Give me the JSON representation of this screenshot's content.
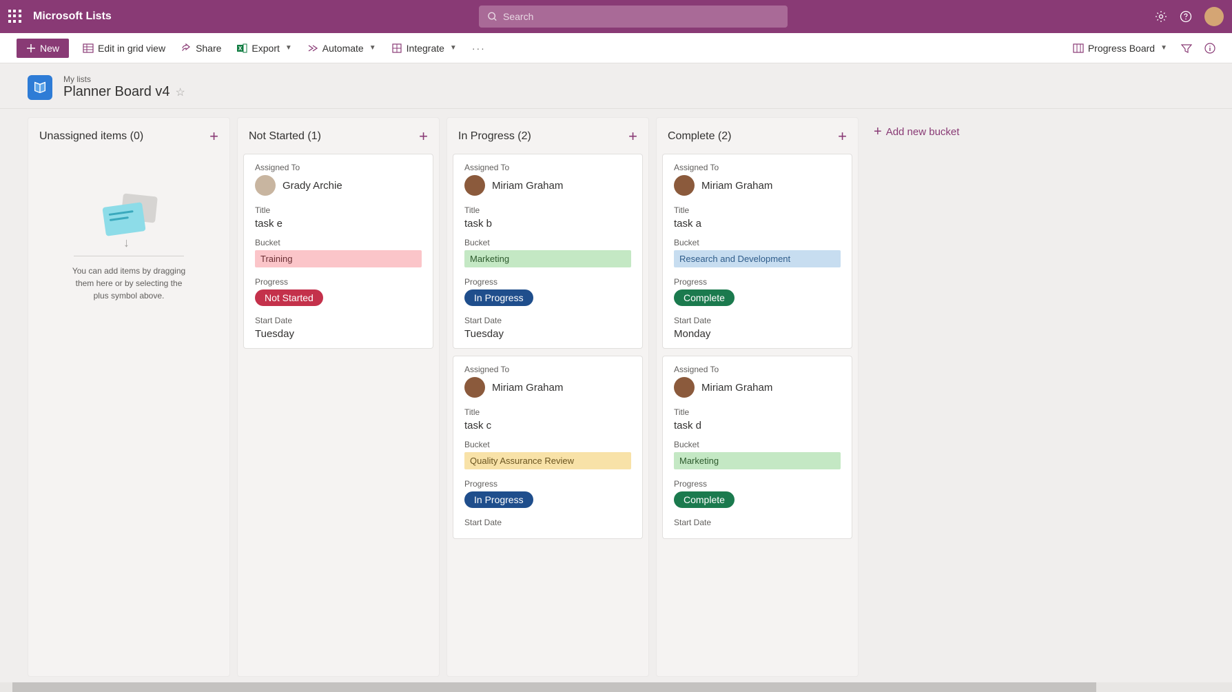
{
  "header": {
    "app_name": "Microsoft Lists",
    "search_placeholder": "Search"
  },
  "commands": {
    "new": "New",
    "edit_grid": "Edit in grid view",
    "share": "Share",
    "export": "Export",
    "automate": "Automate",
    "integrate": "Integrate",
    "view_name": "Progress Board"
  },
  "list": {
    "breadcrumb": "My lists",
    "title": "Planner Board v4"
  },
  "board": {
    "add_bucket": "Add new bucket",
    "columns": [
      {
        "title": "Unassigned items (0)",
        "empty_text": "You can add items by dragging them here or by selecting the plus symbol above."
      },
      {
        "title": "Not Started (1)"
      },
      {
        "title": "In Progress (2)"
      },
      {
        "title": "Complete (2)"
      }
    ]
  },
  "labels": {
    "assigned_to": "Assigned To",
    "title": "Title",
    "bucket": "Bucket",
    "progress": "Progress",
    "start_date": "Start Date"
  },
  "cards": {
    "c1": {
      "assignee": "Grady Archie",
      "title": "task e",
      "bucket": "Training",
      "progress": "Not Started",
      "start_date": "Tuesday"
    },
    "c2": {
      "assignee": "Miriam Graham",
      "title": "task b",
      "bucket": "Marketing",
      "progress": "In Progress",
      "start_date": "Tuesday"
    },
    "c3": {
      "assignee": "Miriam Graham",
      "title": "task c",
      "bucket": "Quality Assurance Review",
      "progress": "In Progress",
      "start_date": ""
    },
    "c4": {
      "assignee": "Miriam Graham",
      "title": "task a",
      "bucket": "Research and Development",
      "progress": "Complete",
      "start_date": "Monday"
    },
    "c5": {
      "assignee": "Miriam Graham",
      "title": "task d",
      "bucket": "Marketing",
      "progress": "Complete",
      "start_date": ""
    }
  }
}
